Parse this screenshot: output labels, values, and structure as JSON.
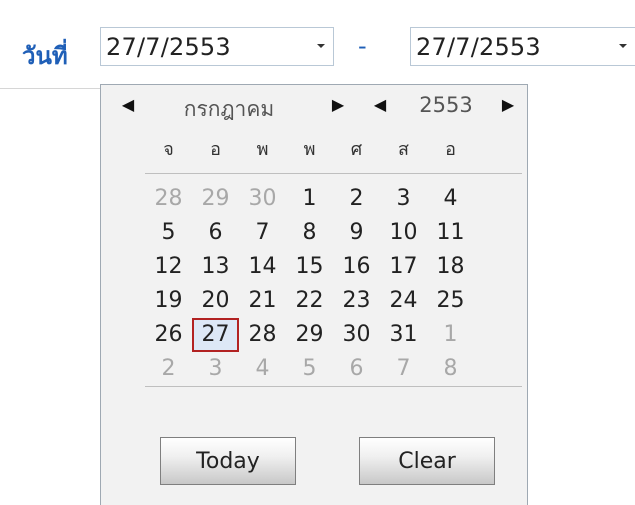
{
  "filter": {
    "label": "วันที่",
    "start_date": "27/7/2553",
    "separator": "-",
    "end_date": "27/7/2553"
  },
  "calendar": {
    "prev_month_icon": "◀",
    "next_month_icon": "▶",
    "prev_year_icon": "◀",
    "next_year_icon": "▶",
    "month": "กรกฎาคม",
    "year": "2553",
    "weekdays": [
      "จ",
      "อ",
      "พ",
      "พ",
      "ศ",
      "ส",
      "อ"
    ],
    "weeks": [
      [
        {
          "d": "28",
          "other": true
        },
        {
          "d": "29",
          "other": true
        },
        {
          "d": "30",
          "other": true
        },
        {
          "d": "1"
        },
        {
          "d": "2"
        },
        {
          "d": "3"
        },
        {
          "d": "4"
        }
      ],
      [
        {
          "d": "5"
        },
        {
          "d": "6"
        },
        {
          "d": "7"
        },
        {
          "d": "8"
        },
        {
          "d": "9"
        },
        {
          "d": "10"
        },
        {
          "d": "11"
        }
      ],
      [
        {
          "d": "12"
        },
        {
          "d": "13"
        },
        {
          "d": "14"
        },
        {
          "d": "15"
        },
        {
          "d": "16"
        },
        {
          "d": "17"
        },
        {
          "d": "18"
        }
      ],
      [
        {
          "d": "19"
        },
        {
          "d": "20"
        },
        {
          "d": "21"
        },
        {
          "d": "22"
        },
        {
          "d": "23"
        },
        {
          "d": "24"
        },
        {
          "d": "25"
        }
      ],
      [
        {
          "d": "26"
        },
        {
          "d": "27",
          "selected": true
        },
        {
          "d": "28"
        },
        {
          "d": "29"
        },
        {
          "d": "30"
        },
        {
          "d": "31"
        },
        {
          "d": "1",
          "other": true
        }
      ],
      [
        {
          "d": "2",
          "other": true
        },
        {
          "d": "3",
          "other": true
        },
        {
          "d": "4",
          "other": true
        },
        {
          "d": "5",
          "other": true
        },
        {
          "d": "6",
          "other": true
        },
        {
          "d": "7",
          "other": true
        },
        {
          "d": "8",
          "other": true
        }
      ]
    ],
    "today_label": "Today",
    "clear_label": "Clear"
  },
  "colors": {
    "label_blue": "#1f5fb7",
    "selected_border": "#b22222",
    "selected_bg": "#dde8f6"
  }
}
